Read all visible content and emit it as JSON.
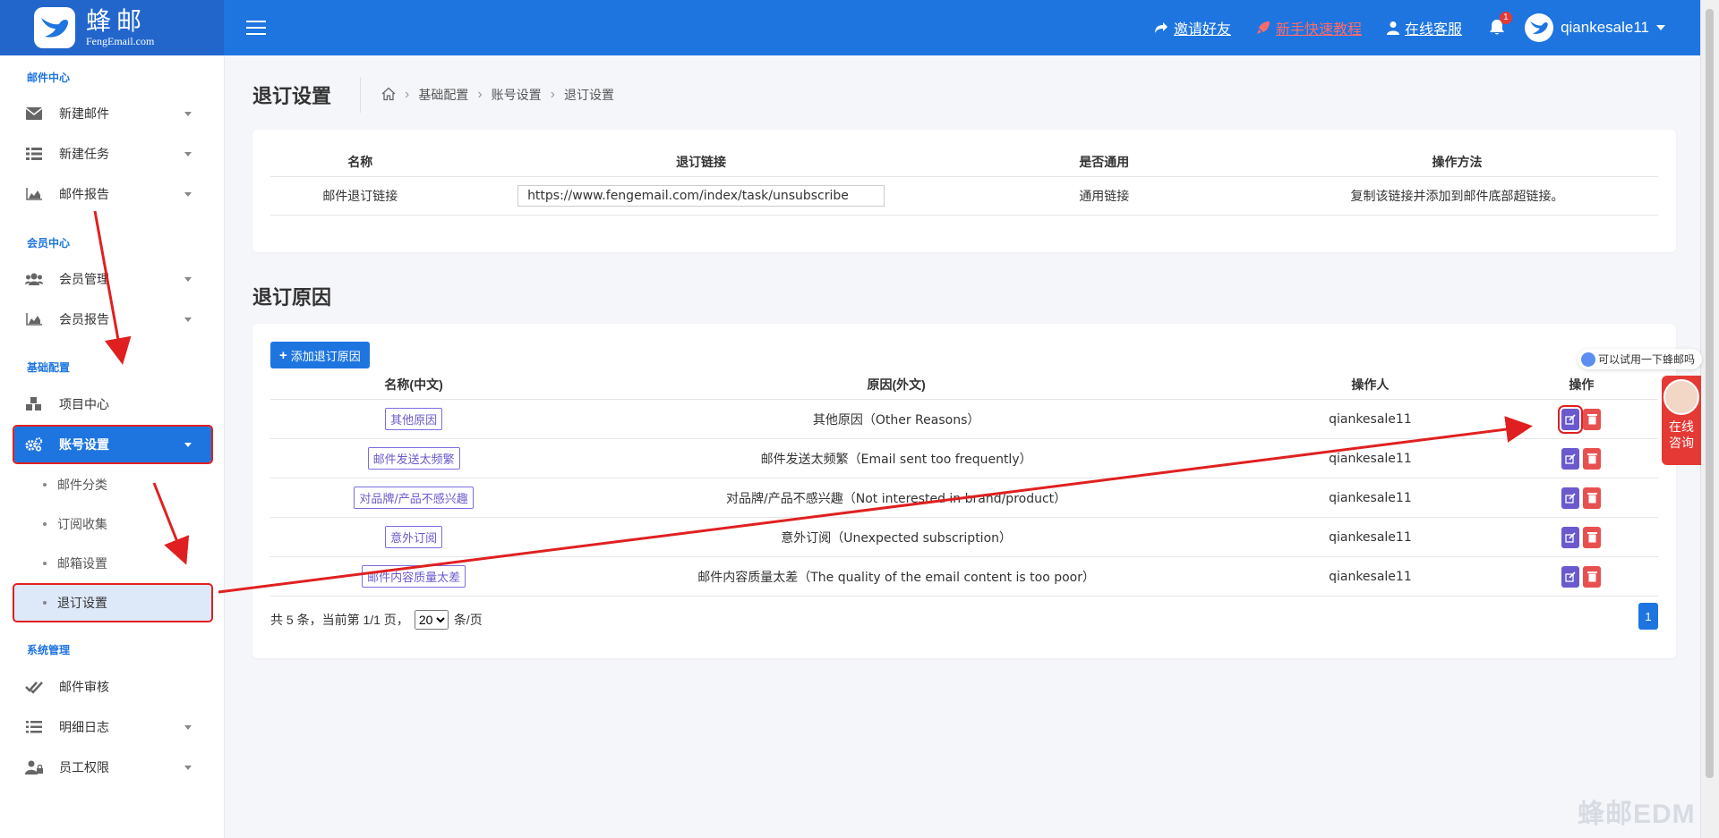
{
  "brand": {
    "name": "蜂邮",
    "sub": "FengEmail.com"
  },
  "topnav": {
    "invite": "邀请好友",
    "tutorial": "新手快速教程",
    "service": "在线客服",
    "bell_count": "1",
    "username": "qiankesale11"
  },
  "sidebar": {
    "sections": {
      "mail": "邮件中心",
      "member": "会员中心",
      "basic": "基础配置",
      "system": "系统管理"
    },
    "items": {
      "new_mail": "新建邮件",
      "new_task": "新建任务",
      "mail_report": "邮件报告",
      "member_manage": "会员管理",
      "member_report": "会员报告",
      "project_center": "项目中心",
      "account_settings": "账号设置",
      "mail_review": "邮件审核",
      "detail_log": "明细日志",
      "staff_perm": "员工权限"
    },
    "sub_items": {
      "mail_category": "邮件分类",
      "subscribe_collect": "订阅收集",
      "mailbox_settings": "邮箱设置",
      "unsubscribe_settings": "退订设置"
    }
  },
  "page": {
    "title": "退订设置",
    "breadcrumb": [
      "基础配置",
      "账号设置",
      "退订设置"
    ]
  },
  "unsub_link_table": {
    "headers": [
      "名称",
      "退订链接",
      "是否通用",
      "操作方法"
    ],
    "row": {
      "name": "邮件退订链接",
      "link": "https://www.fengemail.com/index/task/unsubscribe",
      "general": "通用链接",
      "method": "复制该链接并添加到邮件底部超链接。"
    }
  },
  "reasons": {
    "title": "退订原因",
    "add_button": "添加退订原因",
    "headers": [
      "名称(中文)",
      "原因(外文)",
      "操作人",
      "操作"
    ],
    "rows": [
      {
        "name_cn": "其他原因",
        "reason": "其他原因（Other Reasons）",
        "operator": "qiankesale11"
      },
      {
        "name_cn": "邮件发送太频繁",
        "reason": "邮件发送太频繁（Email sent too frequently）",
        "operator": "qiankesale11"
      },
      {
        "name_cn": "对品牌/产品不感兴趣",
        "reason": "对品牌/产品不感兴趣（Not interested in brand/product）",
        "operator": "qiankesale11"
      },
      {
        "name_cn": "意外订阅",
        "reason": "意外订阅（Unexpected subscription）",
        "operator": "qiankesale11"
      },
      {
        "name_cn": "邮件内容质量太差",
        "reason": "邮件内容质量太差（The quality of the email content is too poor）",
        "operator": "qiankesale11"
      }
    ],
    "pager": {
      "summary": "共 5 条，当前第 1/1 页，",
      "per_page": "20",
      "per_page_suffix": "条/页",
      "current_page": "1"
    }
  },
  "widgets": {
    "chat_hint": "可以试用一下蜂邮吗",
    "consult": [
      "在线",
      "咨询"
    ],
    "watermark": "蜂邮EDM"
  },
  "colors": {
    "primary": "#1e75e0",
    "annotation_red": "#e02020",
    "edit": "#6a5acd",
    "delete": "#e85050"
  }
}
